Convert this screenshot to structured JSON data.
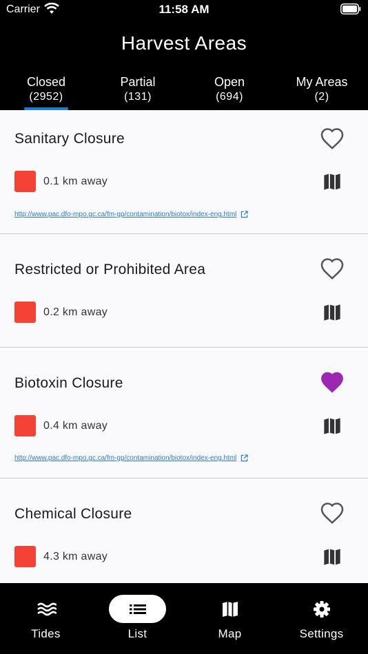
{
  "status_bar": {
    "carrier": "Carrier",
    "time": "11:58 AM"
  },
  "header": {
    "title": "Harvest Areas"
  },
  "tabs": [
    {
      "label": "Closed",
      "count": "(2952)",
      "selected": true
    },
    {
      "label": "Partial",
      "count": "(131)",
      "selected": false
    },
    {
      "label": "Open",
      "count": "(694)",
      "selected": false
    },
    {
      "label": "My Areas",
      "count": "(2)",
      "selected": false
    }
  ],
  "cards": [
    {
      "title": "Sanitary Closure",
      "distance": "0.1 km away",
      "favorite": false,
      "link": "http://www.pac.dfo-mpo.gc.ca/fm-gp/contamination/biotox/index-eng.html"
    },
    {
      "title": "Restricted or Prohibited Area",
      "distance": "0.2 km away",
      "favorite": false,
      "link": ""
    },
    {
      "title": "Biotoxin Closure",
      "distance": "0.4 km away",
      "favorite": true,
      "link": "http://www.pac.dfo-mpo.gc.ca/fm-gp/contamination/biotox/index-eng.html"
    },
    {
      "title": "Chemical Closure",
      "distance": "4.3 km away",
      "favorite": false,
      "link": ""
    }
  ],
  "bottom_nav": [
    {
      "label": "Tides",
      "icon": "waves-icon",
      "selected": false
    },
    {
      "label": "List",
      "icon": "list-icon",
      "selected": true
    },
    {
      "label": "Map",
      "icon": "map-icon",
      "selected": false
    },
    {
      "label": "Settings",
      "icon": "gear-icon",
      "selected": false
    }
  ],
  "colors": {
    "status_closed": "#f44336",
    "favorite_active": "#9c27b0",
    "favorite_inactive": "#555555",
    "tab_indicator": "#1a7fd0",
    "link": "#2a7bd5"
  }
}
